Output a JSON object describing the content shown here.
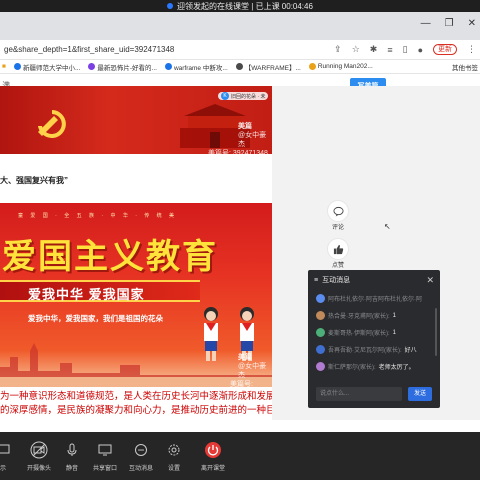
{
  "share_banner": {
    "text": "迎领发起的在线课堂 | 已上课 00:04:46"
  },
  "browser": {
    "url": "ge&share_depth=1&first_share_uid=392471348",
    "update_label": "更新",
    "bookmarks": [
      {
        "label": "新疆师范大学中小...",
        "color": "#1a73e8"
      },
      {
        "label": "最新恐怖片-好看的...",
        "color": "#7b3fe4"
      },
      {
        "label": "warframe 中断攻...",
        "color": "#1a73e8"
      },
      {
        "label": "【WARFRAME】...",
        "color": "#4a4a4a"
      },
      {
        "label": "Running Man202...",
        "color": "#e8a31a"
      }
    ],
    "bookmarks_right": "其他书签"
  },
  "page": {
    "header_partial": "满",
    "write_button": "写美篇"
  },
  "article": {
    "author_chip": "旧回的花朵 · 未",
    "watermark1": {
      "logo": "美篇",
      "author": "@女中豪杰",
      "id": "美篇号: 392471348"
    },
    "heading": "大、强国复兴有我”",
    "poster": {
      "topline": "童 爱 国 · 全 五 族 · 中 华 · 传 统 美",
      "title": "爱国主义教育",
      "ribbon": "爱我中华 爱我国家",
      "subline": "爱我中华，爱我国家，我们是祖国的花朵"
    },
    "watermark2": {
      "logo": "美篇",
      "author": "@女中豪杰",
      "id": "美篇号: 392471348"
    },
    "body_lines": [
      "为一种意识形态和道德规范，是人类在历史长河中逐渐形成和发展起",
      "的深厚感情，是民族的凝聚力和向心力，是推动历史前进的一种巨大"
    ]
  },
  "actions": {
    "comment": "评论",
    "like": "点赞"
  },
  "chat": {
    "title": "互动消息",
    "messages": [
      {
        "name": "阿布杜扎依尔·阿吉阿布杜扎依尔·阿",
        "text": "",
        "color": "#5b8def"
      },
      {
        "name": "热合曼·牙克甫阿(家长):",
        "text": "1",
        "color": "#c08a5a"
      },
      {
        "name": "麦斯哥热·伊斯阿(家长):",
        "text": "1",
        "color": "#4caf7a"
      },
      {
        "name": "吾再吾勒·艾尼瓦尔阿(家长):",
        "text": "好八",
        "color": "#3f6fd1"
      },
      {
        "name": "斯仁萨那尔(家长):",
        "text": "老师太厉了。",
        "color": "#b07bd0"
      }
    ],
    "input_placeholder": "说点什么...",
    "send_label": "发送"
  },
  "toolbar": {
    "items": [
      {
        "label": "示"
      },
      {
        "label": "开摄像头"
      },
      {
        "label": "静音"
      },
      {
        "label": "共享窗口"
      },
      {
        "label": "互动消息"
      },
      {
        "label": "设置"
      },
      {
        "label": "离开课堂"
      }
    ]
  }
}
